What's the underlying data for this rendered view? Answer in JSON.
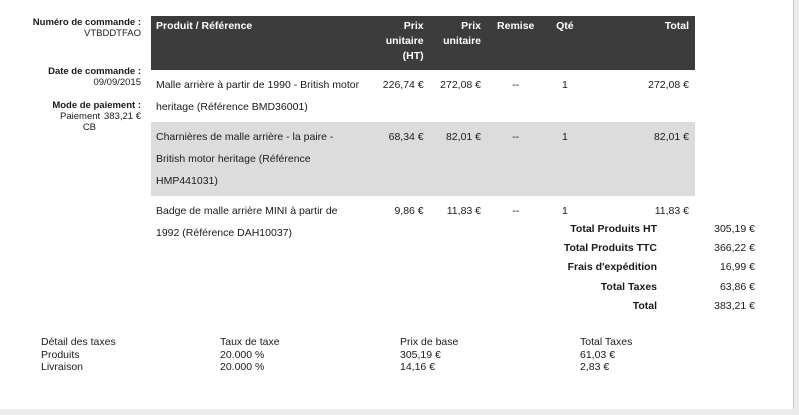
{
  "order": {
    "number_label": "Numéro de commande :",
    "number": "VTBDDTFAO",
    "date_label": "Date de commande :",
    "date": "09/09/2015",
    "payment_label": "Mode de paiement :",
    "payment_method": "Paiement CB",
    "payment_amount": "383,21 €"
  },
  "table": {
    "headers": {
      "product": "Produit / Référence",
      "price_ht": "Prix unitaire (HT)",
      "price_ttc": "Prix unitaire",
      "discount": "Remise",
      "qty": "Qté",
      "total": "Total"
    },
    "rows": [
      {
        "product": "Malle arrière à partir de 1990 - British motor heritage (Référence BMD36001)",
        "price_ht": "226,74 €",
        "price_ttc": "272,08 €",
        "discount": "--",
        "qty": "1",
        "total": "272,08 €"
      },
      {
        "product": "Charnières de malle arrière - la paire - British motor heritage (Référence HMP441031)",
        "price_ht": "68,34 €",
        "price_ttc": "82,01 €",
        "discount": "--",
        "qty": "1",
        "total": "82,01 €"
      },
      {
        "product": "Badge de malle arrière MINI à partir de 1992 (Référence DAH10037)",
        "price_ht": "9,86 €",
        "price_ttc": "11,83 €",
        "discount": "--",
        "qty": "1",
        "total": "11,83 €"
      }
    ]
  },
  "totals": [
    {
      "label": "Total Produits HT",
      "value": "305,19 €"
    },
    {
      "label": "Total Produits TTC",
      "value": "366,22 €"
    },
    {
      "label": "Frais d'expédition",
      "value": "16,99 €"
    },
    {
      "label": "Total Taxes",
      "value": "63,86 €"
    },
    {
      "label": "Total",
      "value": "383,21 €"
    }
  ],
  "tax_detail": {
    "headers": [
      "Détail des taxes",
      "Taux de taxe",
      "Prix de base",
      "Total Taxes"
    ],
    "rows": [
      [
        "Produits",
        "20.000 %",
        "305,19 €",
        "61,03 €"
      ],
      [
        "Livraison",
        "20.000 %",
        "14,16 €",
        "2,83 €"
      ]
    ]
  }
}
